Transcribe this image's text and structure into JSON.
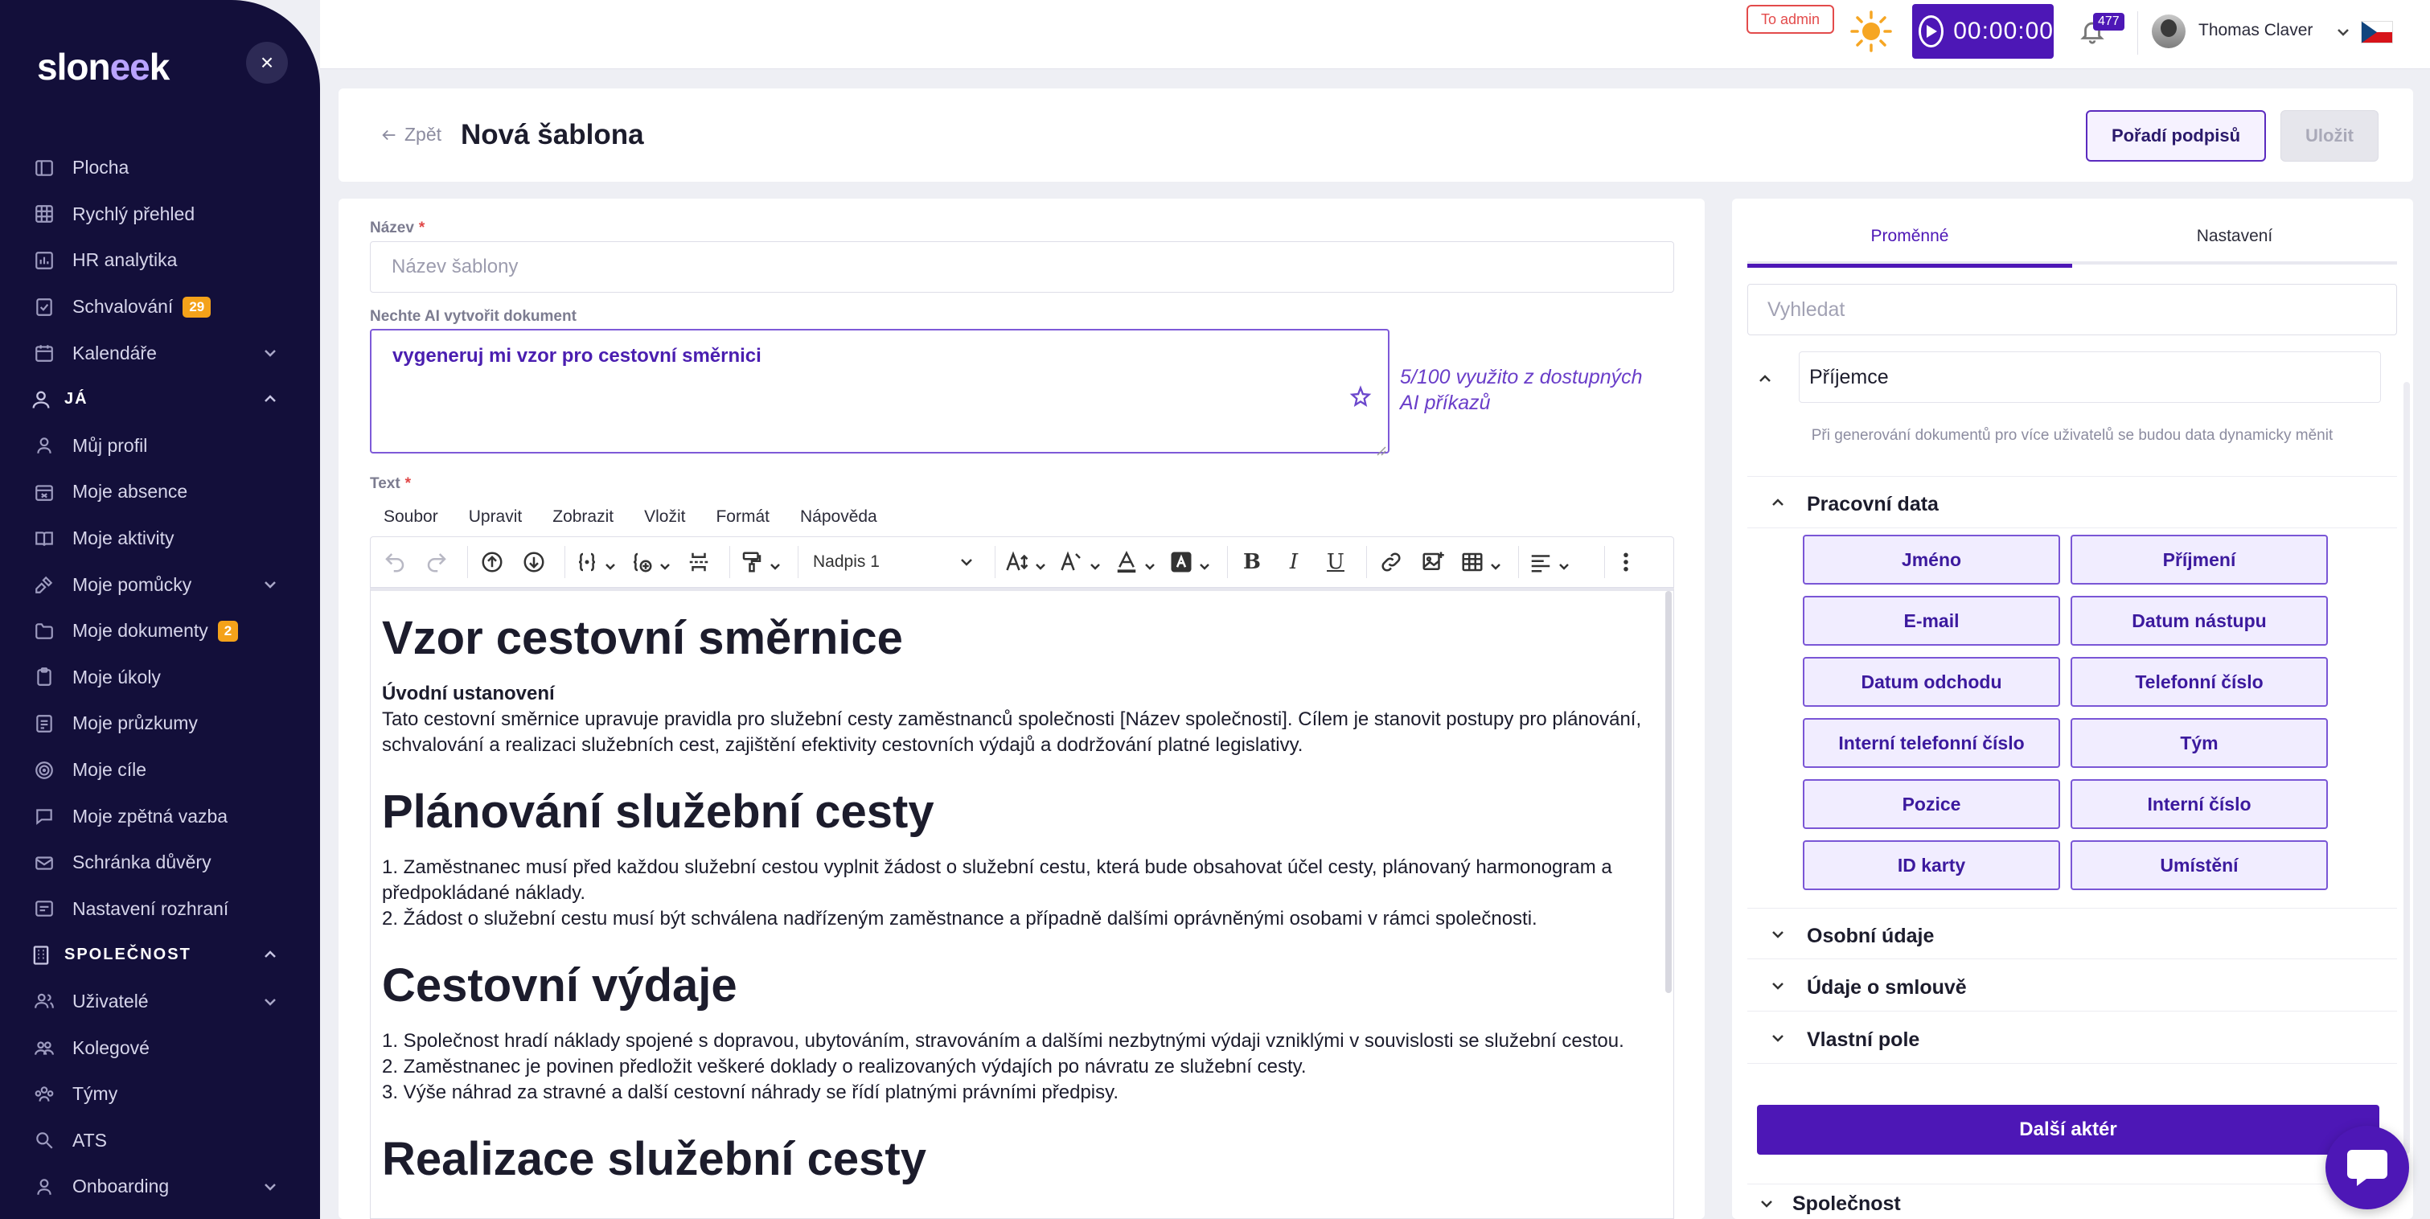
{
  "app": {
    "logo": {
      "a": "slon",
      "b": "ee",
      "c": "k"
    },
    "close": "×"
  },
  "sidebar": {
    "items": [
      {
        "label": "Plocha",
        "icon": "dashboard-icon"
      },
      {
        "label": "Rychlý přehled",
        "icon": "grid-icon"
      },
      {
        "label": "HR analytika",
        "icon": "chart-icon"
      },
      {
        "label": "Schvalování",
        "icon": "approval-icon",
        "badge": "29"
      },
      {
        "label": "Kalendáře",
        "icon": "calendar-icon",
        "chevron": "down"
      }
    ],
    "me_section": "JÁ",
    "me_items": [
      {
        "label": "Můj profil",
        "icon": "user-icon"
      },
      {
        "label": "Moje absence",
        "icon": "absence-icon"
      },
      {
        "label": "Moje aktivity",
        "icon": "book-icon"
      },
      {
        "label": "Moje pomůcky",
        "icon": "tools-icon",
        "chevron": "down"
      },
      {
        "label": "Moje dokumenty",
        "icon": "folder-icon",
        "badge": "2"
      },
      {
        "label": "Moje úkoly",
        "icon": "clipboard-icon"
      },
      {
        "label": "Moje průzkumy",
        "icon": "survey-icon"
      },
      {
        "label": "Moje cíle",
        "icon": "target-icon"
      },
      {
        "label": "Moje zpětná vazba",
        "icon": "feedback-icon"
      },
      {
        "label": "Schránka důvěry",
        "icon": "mailbox-icon"
      },
      {
        "label": "Nastavení rozhraní",
        "icon": "settings-icon"
      }
    ],
    "company_section": "SPOLEČNOST",
    "company_items": [
      {
        "label": "Uživatelé",
        "icon": "users-icon",
        "chevron": "down"
      },
      {
        "label": "Kolegové",
        "icon": "colleagues-icon"
      },
      {
        "label": "Týmy",
        "icon": "teams-icon"
      },
      {
        "label": "ATS",
        "icon": "ats-icon"
      },
      {
        "label": "Onboarding",
        "icon": "onboarding-icon",
        "chevron": "down"
      }
    ]
  },
  "topbar": {
    "to_admin": "To admin",
    "timer": "00:00:00",
    "notifications": "477",
    "user_name": "Thomas Claver"
  },
  "header": {
    "back": "Zpět",
    "title": "Nová šablona",
    "order_button": "Pořadí podpisů",
    "save_button": "Uložit"
  },
  "form": {
    "name_label": "Název",
    "required_mark": "*",
    "name_placeholder": "Název šablony",
    "ai_label": "Nechte AI vytvořit dokument",
    "ai_prompt": "vygeneruj mi vzor pro cestovní směrnici",
    "ai_usage": "5/100 využito z dostupných AI příkazů",
    "text_label": "Text",
    "menubar": [
      "Soubor",
      "Upravit",
      "Zobrazit",
      "Vložit",
      "Formát",
      "Nápověda"
    ],
    "block_format": "Nadpis 1",
    "toolbar_glyphs": {
      "bold": "B",
      "italic": "I",
      "underline": "U"
    }
  },
  "document": {
    "h1": "Vzor cestovní směrnice",
    "intro_title": "Úvodní ustanovení",
    "intro_text": "Tato cestovní směrnice upravuje pravidla pro služební cesty zaměstnanců společnosti [Název společnosti]. Cílem je stanovit postupy pro plánování, schvalování a realizaci služebních cest, zajištění efektivity cestovních výdajů a dodržování platné legislativy.",
    "h2": "Plánování služební cesty",
    "plan_1": "1. Zaměstnanec musí před každou služební cestou vyplnit žádost o služební cestu, která bude obsahovat účel cesty, plánovaný harmonogram a předpokládané náklady.",
    "plan_2": "2. Žádost o služební cestu musí být schválena nadřízeným zaměstnance a případně dalšími oprávněnými osobami v rámci společnosti.",
    "h3": "Cestovní výdaje",
    "exp_1": "1. Společnost hradí náklady spojené s dopravou, ubytováním, stravováním a dalšími nezbytnými výdaji vzniklými v souvislosti se služební cestou.",
    "exp_2": "2. Zaměstnanec je povinen předložit veškeré doklady o realizovaných výdajích po návratu ze služební cesty.",
    "exp_3": "3. Výše náhrad za stravné a další cestovní náhrady se řídí platnými právními předpisy.",
    "h4": "Realizace služební cesty"
  },
  "panel": {
    "tab_variables": "Proměnné",
    "tab_settings": "Nastavení",
    "search_placeholder": "Vyhledat",
    "recipient": "Příjemce",
    "recipient_note": "Při generování dokumentů pro více uživatelů se budou data dynamicky měnit",
    "work_data": "Pracovní data",
    "variables": [
      "Jméno",
      "Příjmení",
      "E-mail",
      "Datum nástupu",
      "Datum odchodu",
      "Telefonní číslo",
      "Interní telefonní číslo",
      "Tým",
      "Pozice",
      "Interní číslo",
      "ID karty",
      "Umístění"
    ],
    "personal": "Osobní údaje",
    "contract": "Údaje o smlouvě",
    "custom": "Vlastní pole",
    "next_actor": "Další aktér",
    "company": "Společnost"
  },
  "colors": {
    "accent": "#4d17b6",
    "sidebar": "#130f3a",
    "badge": "#f4a21a",
    "danger": "#e34b4b"
  }
}
